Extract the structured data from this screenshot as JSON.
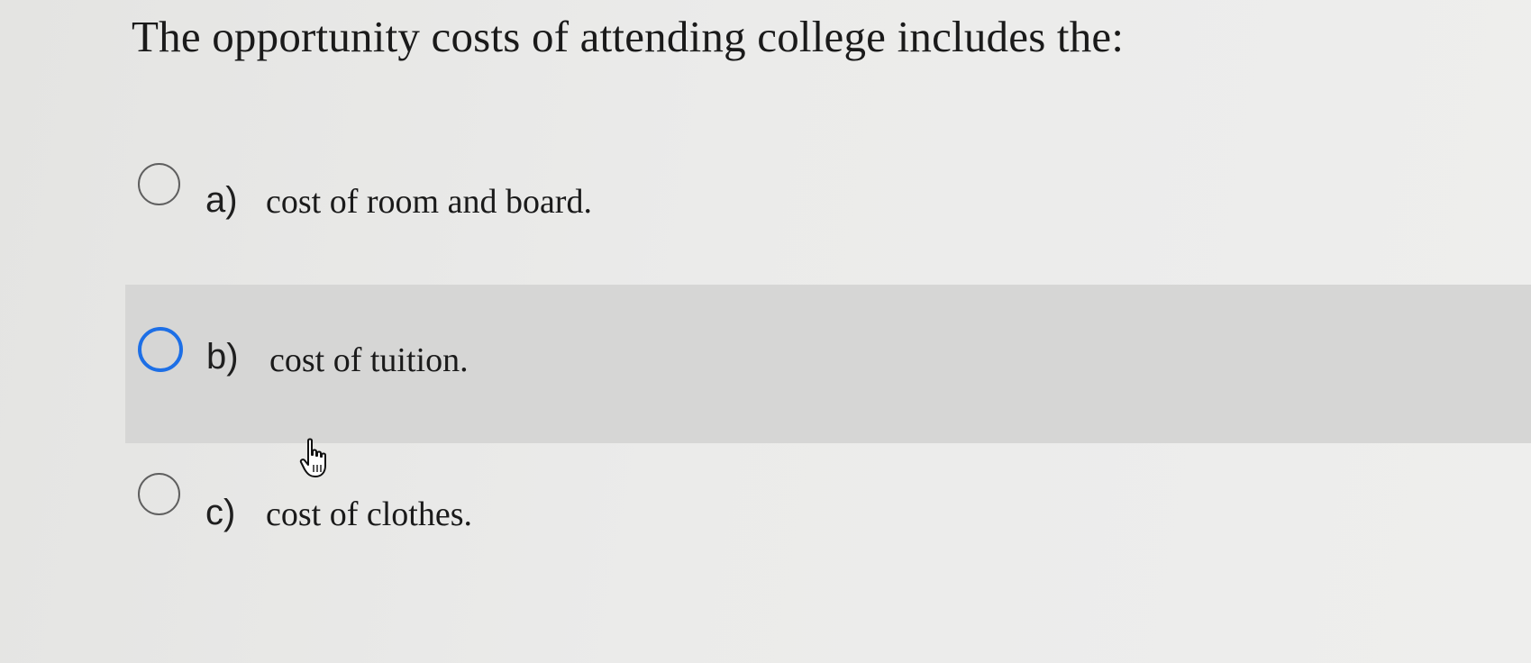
{
  "question": {
    "text": "The opportunity costs of attending college includes the:"
  },
  "options": [
    {
      "letter": "a)",
      "text": "cost of room and board.",
      "selected": false,
      "highlighted": false
    },
    {
      "letter": "b)",
      "text": "cost of tuition.",
      "selected": false,
      "highlighted": true
    },
    {
      "letter": "c)",
      "text": "cost of clothes.",
      "selected": false,
      "highlighted": false
    }
  ],
  "colors": {
    "highlight_row": "#d6d6d5",
    "focus_ring": "#1d6fe6",
    "radio_border": "#5f5f5f"
  },
  "cursor": {
    "icon": "hand-pointer-icon"
  }
}
